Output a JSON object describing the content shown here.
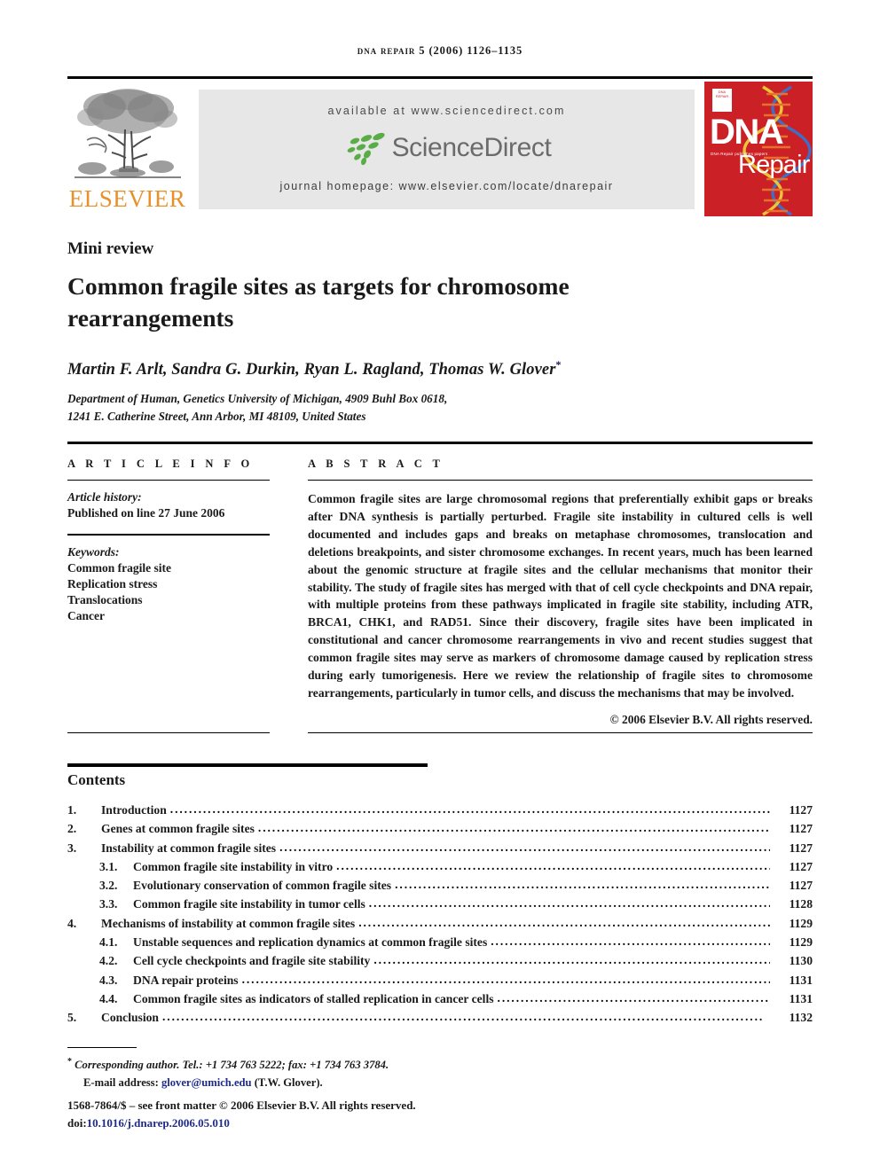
{
  "running_head": {
    "journal": "DNA Repair",
    "citation": "5 (2006) 1126–1135",
    "full": "DNA REPAIR 5 (2006) 1126–1135"
  },
  "masthead": {
    "publisher_name": "ELSEVIER",
    "available_at": "available at www.sciencedirect.com",
    "sciencedirect_wordmark": "ScienceDirect",
    "journal_homepage": "journal homepage: www.elsevier.com/locate/dnarepair",
    "cover": {
      "title_line1": "DNA",
      "title_line2": "Repair",
      "subtitle": "DNA Repair publishes papers",
      "badge_text": "DNA REPAIR",
      "background_color": "#cc2027"
    },
    "accent_colors": {
      "elsevier_orange": "#E8912A",
      "sciencedirect_green": "#4caf50",
      "sciencedirect_gray": "#6b6b6b",
      "cover_red": "#cc2027",
      "link_blue": "#1e2a8c"
    }
  },
  "article": {
    "section_label": "Mini review",
    "title": "Common fragile sites as targets for chromosome rearrangements",
    "authors": "Martin F. Arlt, Sandra G. Durkin, Ryan L. Ragland, Thomas W. Glover",
    "corresponding_marker": "*",
    "affiliation_line1": "Department of Human, Genetics University of Michigan, 4909 Buhl Box 0618,",
    "affiliation_line2": "1241 E. Catherine Street, Ann Arbor, MI 48109, United States"
  },
  "article_info": {
    "heading": "A R T I C L E    I N F O",
    "history_label": "Article history:",
    "history_value": "Published on line 27 June 2006",
    "keywords_label": "Keywords:",
    "keywords": [
      "Common fragile site",
      "Replication stress",
      "Translocations",
      "Cancer"
    ]
  },
  "abstract": {
    "heading": "A B S T R A C T",
    "body": "Common fragile sites are large chromosomal regions that preferentially exhibit gaps or breaks after DNA synthesis is partially perturbed. Fragile site instability in cultured cells is well documented and includes gaps and breaks on metaphase chromosomes, translocation and deletions breakpoints, and sister chromosome exchanges. In recent years, much has been learned about the genomic structure at fragile sites and the cellular mechanisms that monitor their stability. The study of fragile sites has merged with that of cell cycle checkpoints and DNA repair, with multiple proteins from these pathways implicated in fragile site stability, including ATR, BRCA1, CHK1, and RAD51. Since their discovery, fragile sites have been implicated in constitutional and cancer chromosome rearrangements in vivo and recent studies suggest that common fragile sites may serve as markers of chromosome damage caused by replication stress during early tumorigenesis. Here we review the relationship of fragile sites to chromosome rearrangements, particularly in tumor cells, and discuss the mechanisms that may be involved.",
    "copyright": "© 2006 Elsevier B.V. All rights reserved."
  },
  "contents": {
    "heading": "Contents",
    "entries": [
      {
        "number": "1.",
        "label": "Introduction",
        "page": "1127",
        "level": 1
      },
      {
        "number": "2.",
        "label": "Genes at common fragile sites",
        "page": "1127",
        "level": 1
      },
      {
        "number": "3.",
        "label": "Instability at common fragile sites",
        "page": "1127",
        "level": 1
      },
      {
        "number": "3.1.",
        "label": "Common fragile site instability in vitro",
        "page": "1127",
        "level": 2
      },
      {
        "number": "3.2.",
        "label": "Evolutionary conservation of common fragile sites",
        "page": "1127",
        "level": 2
      },
      {
        "number": "3.3.",
        "label": "Common fragile site instability in tumor cells",
        "page": "1128",
        "level": 2
      },
      {
        "number": "4.",
        "label": "Mechanisms of instability at common fragile sites",
        "page": "1129",
        "level": 1
      },
      {
        "number": "4.1.",
        "label": "Unstable sequences and replication dynamics at common fragile sites",
        "page": "1129",
        "level": 2
      },
      {
        "number": "4.2.",
        "label": "Cell cycle checkpoints and fragile site stability",
        "page": "1130",
        "level": 2
      },
      {
        "number": "4.3.",
        "label": "DNA repair proteins",
        "page": "1131",
        "level": 2
      },
      {
        "number": "4.4.",
        "label": "Common fragile sites as indicators of stalled replication in cancer cells",
        "page": "1131",
        "level": 2
      },
      {
        "number": "5.",
        "label": "Conclusion",
        "page": "1132",
        "level": 1
      }
    ]
  },
  "footer": {
    "corresponding_marker": "*",
    "corresponding_text": "Corresponding author. Tel.: +1 734 763 5222; fax: +1 734 763 3784.",
    "email_label": "E-mail address:",
    "email": "glover@umich.edu",
    "email_owner": "(T.W. Glover).",
    "imprint": "1568-7864/$ – see front matter © 2006 Elsevier B.V. All rights reserved.",
    "doi_label": "doi:",
    "doi": "10.1016/j.dnarep.2006.05.010"
  }
}
